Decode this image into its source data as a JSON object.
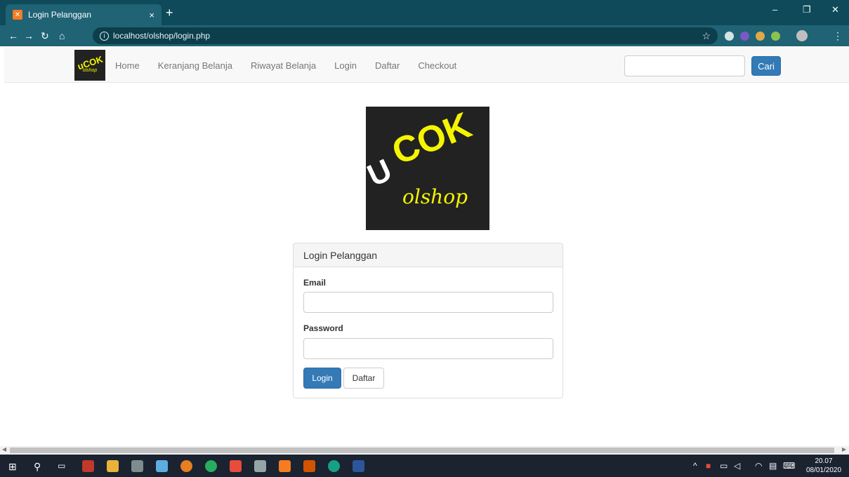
{
  "browser": {
    "tab_title": "Login Pelanggan",
    "tab_close": "×",
    "new_tab": "+",
    "url": "localhost/olshop/login.php",
    "minimize": "–",
    "restore": "❐",
    "close": "✕"
  },
  "navbar": {
    "brand_big": "uCOK",
    "brand_small": "olshop",
    "links": [
      "Home",
      "Keranjang Belanja",
      "Riwayat Belanja",
      "Login",
      "Daftar",
      "Checkout"
    ],
    "search_placeholder": "",
    "search_button": "Cari"
  },
  "logo": {
    "part1": "U",
    "part2": "COK",
    "part3": "olshop"
  },
  "login_panel": {
    "heading": "Login Pelanggan",
    "email_label": "Email",
    "email_value": "",
    "password_label": "Password",
    "password_value": "",
    "login_button": "Login",
    "daftar_button": "Daftar"
  },
  "taskbar": {
    "time": "20.07",
    "date": "08/01/2020"
  },
  "colors": {
    "primary": "#337ab7",
    "chrome": "#0e4a5a",
    "logo_yellow": "#f5f500"
  }
}
